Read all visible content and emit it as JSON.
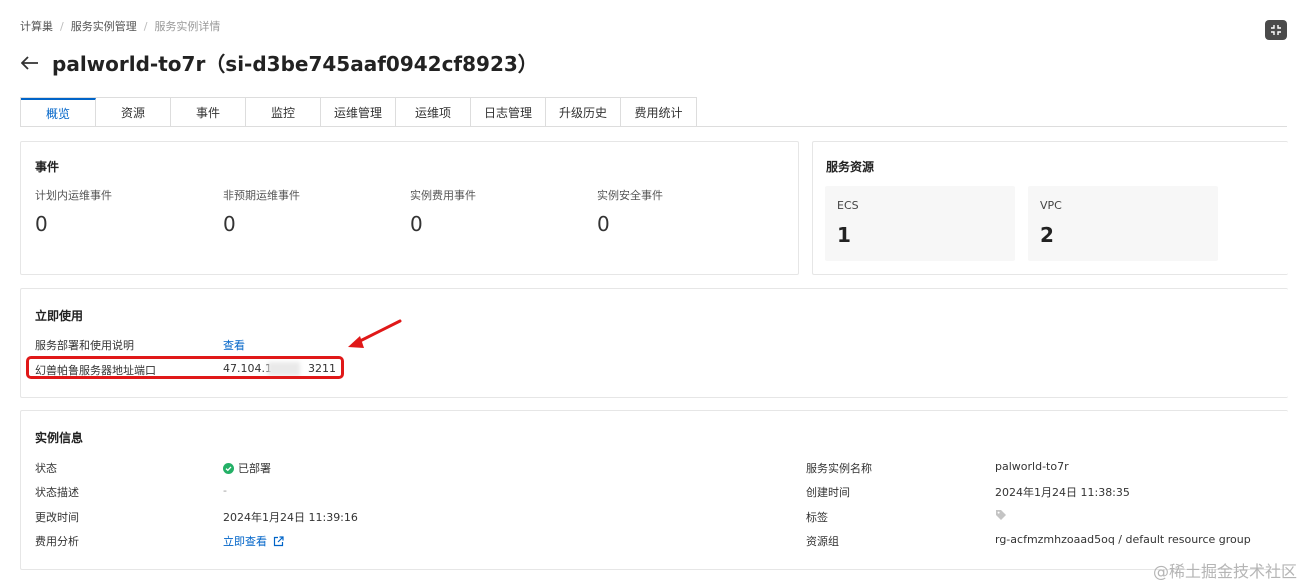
{
  "breadcrumb": [
    "计算巢",
    "服务实例管理",
    "服务实例详情"
  ],
  "page_title": "palworld-to7r（si-d3be745aaf0942cf8923）",
  "tabs": [
    "概览",
    "资源",
    "事件",
    "监控",
    "运维管理",
    "运维项",
    "日志管理",
    "升级历史",
    "费用统计"
  ],
  "active_tab": "概览",
  "events": {
    "title": "事件",
    "items": [
      {
        "label": "计划内运维事件",
        "value": "0"
      },
      {
        "label": "非预期运维事件",
        "value": "0"
      },
      {
        "label": "实例费用事件",
        "value": "0"
      },
      {
        "label": "实例安全事件",
        "value": "0"
      }
    ]
  },
  "resources": {
    "title": "服务资源",
    "items": [
      {
        "label": "ECS",
        "value": "1"
      },
      {
        "label": "VPC",
        "value": "2"
      }
    ]
  },
  "quick_use": {
    "title": "立即使用",
    "rows": [
      {
        "label": "服务部署和使用说明",
        "value": "查看"
      },
      {
        "label": "幻兽帕鲁服务器地址端口",
        "value_prefix": "47.104.1",
        "value_suffix": "3211"
      }
    ]
  },
  "instance_info": {
    "title": "实例信息",
    "left": [
      {
        "label": "状态",
        "value": "已部署"
      },
      {
        "label": "状态描述",
        "value": "-"
      },
      {
        "label": "更改时间",
        "value": "2024年1月24日 11:39:16"
      },
      {
        "label": "费用分析",
        "value": "立即查看"
      }
    ],
    "right": [
      {
        "label": "服务实例名称",
        "value": "palworld-to7r"
      },
      {
        "label": "创建时间",
        "value": "2024年1月24日 11:38:35"
      },
      {
        "label": "标签",
        "value": ""
      },
      {
        "label": "资源组",
        "value": "rg-acfmzmhzoaad5oq / default resource group"
      }
    ]
  },
  "colors": {
    "accent": "#0064c8",
    "success": "#23b066",
    "annotation": "#e01818"
  },
  "watermark": "@稀土掘金技术社区"
}
